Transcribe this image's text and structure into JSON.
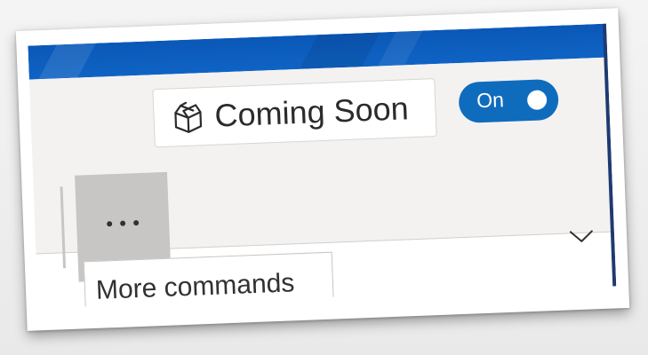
{
  "header": {
    "coming_soon_label": "Coming Soon",
    "toggle": {
      "label": "On",
      "state": "on"
    }
  },
  "ribbon": {
    "more_commands_tooltip": "More commands"
  },
  "icons": {
    "coming_soon": "gift-box-icon",
    "more": "ellipsis-icon",
    "collapse": "chevron-down-icon"
  },
  "colors": {
    "titlebar": "#0f63c4",
    "toggle_on": "#0f6cbd",
    "ribbon_bg": "#f3f2f1",
    "button_hover": "#c8c6c4"
  }
}
